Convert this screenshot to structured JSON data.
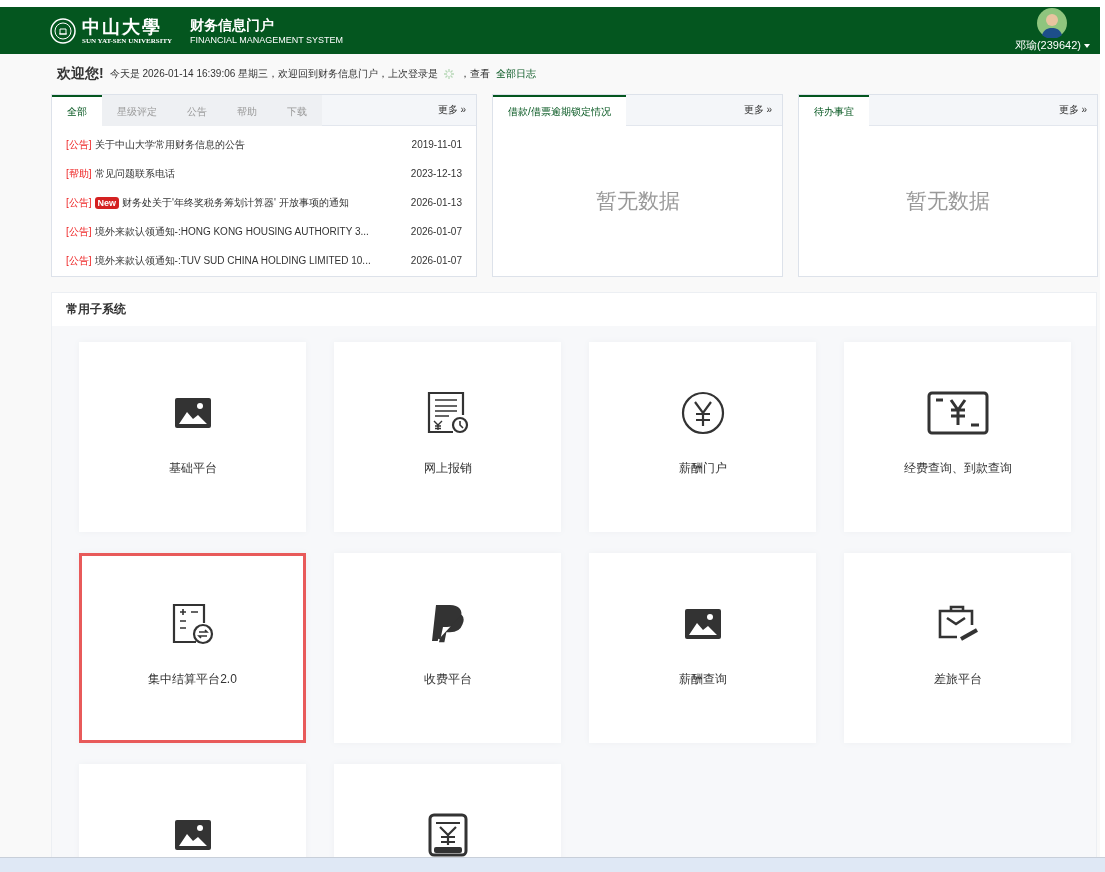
{
  "header": {
    "logo_cn": "中山大學",
    "logo_en": "SUN YAT-SEN UNIVERSITY",
    "title": "财务信息门户",
    "subtitle": "FINANCIAL MANAGEMENT SYSTEM",
    "user": "邓瑜(239642)"
  },
  "welcome": {
    "greeting": "欢迎您!",
    "message": "今天是 2026-01-14 16:39:06 星期三，欢迎回到财务信息门户，上次登录是",
    "separator": "，查看",
    "link": "全部日志"
  },
  "notices": {
    "tabs": [
      {
        "label": "全部",
        "selected": true
      },
      {
        "label": "星级评定",
        "selected": false
      },
      {
        "label": "公告",
        "selected": false
      },
      {
        "label": "帮助",
        "selected": false
      },
      {
        "label": "下载",
        "selected": false
      }
    ],
    "more": "更多 »",
    "items": [
      {
        "tag": "[公告]",
        "title": "关于中山大学常用财务信息的公告",
        "date": "2019-11-01"
      },
      {
        "tag": "[帮助]",
        "title": "常见问题联系电话",
        "date": "2023-12-13"
      },
      {
        "tag": "[公告]",
        "badge": "New",
        "title": "财务处关于'年终奖税务筹划计算器' 开放事项的通知",
        "date": "2026-01-13"
      },
      {
        "tag": "[公告]",
        "title": "境外来款认领通知-:HONG KONG HOUSING AUTHORITY 3...",
        "date": "2026-01-07"
      },
      {
        "tag": "[公告]",
        "title": "境外来款认领通知-:TUV SUD CHINA HOLDING LIMITED 10...",
        "date": "2026-01-07"
      }
    ]
  },
  "panels": [
    {
      "tab": "借款/借票逾期锁定情况",
      "more": "更多 »",
      "empty": "暂无数据"
    },
    {
      "tab": "待办事宜",
      "more": "更多 »",
      "empty": "暂无数据"
    }
  ],
  "subsystems": {
    "title": "常用子系统",
    "tiles": [
      {
        "kind": "image",
        "label": "基础平台",
        "selected": false
      },
      {
        "kind": "receipt",
        "label": "网上报销",
        "selected": false
      },
      {
        "kind": "yencircle",
        "label": "薪酬门户",
        "selected": false
      },
      {
        "kind": "screen",
        "label": "经费查询、到款查询",
        "selected": false
      },
      {
        "kind": "calculator",
        "label": "集中结算平台2.0",
        "selected": true
      },
      {
        "kind": "pay",
        "label": "收费平台",
        "selected": false
      },
      {
        "kind": "image",
        "label": "薪酬查询",
        "selected": false
      },
      {
        "kind": "briefcase",
        "label": "差旅平台",
        "selected": false
      },
      {
        "kind": "image",
        "selected": false
      },
      {
        "kind": "document",
        "selected": false
      }
    ]
  }
}
